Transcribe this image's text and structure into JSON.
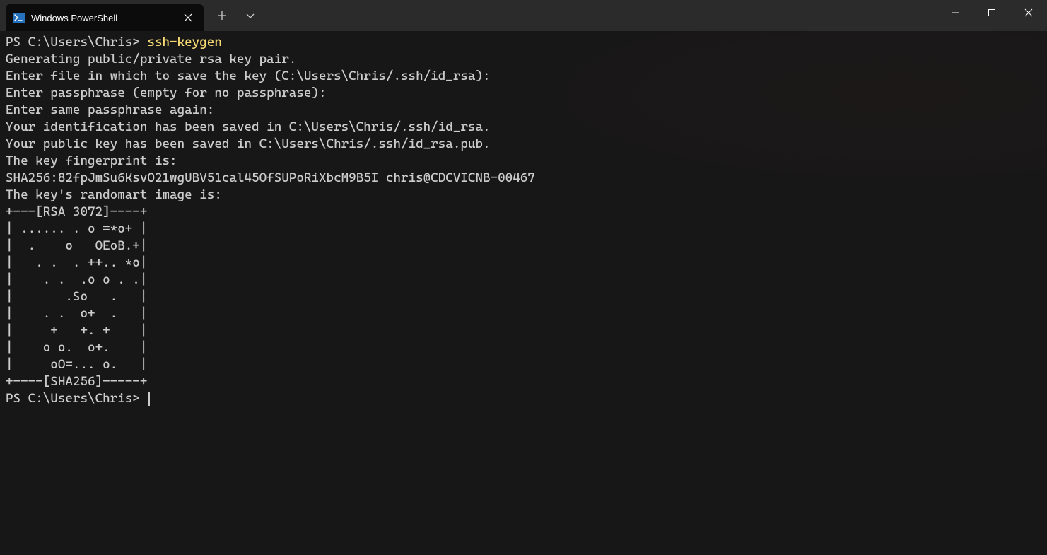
{
  "titlebar": {
    "tab_title": "Windows PowerShell",
    "new_tab_icon": "plus-icon",
    "dropdown_icon": "chevron-down-icon"
  },
  "terminal": {
    "prompt1": "PS C:\\Users\\Chris> ",
    "command1": "ssh-keygen",
    "lines": [
      "Generating public/private rsa key pair.",
      "Enter file in which to save the key (C:\\Users\\Chris/.ssh/id_rsa):",
      "Enter passphrase (empty for no passphrase):",
      "Enter same passphrase again:",
      "Your identification has been saved in C:\\Users\\Chris/.ssh/id_rsa.",
      "Your public key has been saved in C:\\Users\\Chris/.ssh/id_rsa.pub.",
      "The key fingerprint is:",
      "SHA256:82fpJmSu6KsvO21wgUBV51cal45OfSUPoRiXbcM9B5I chris@CDCVICNB-00467",
      "The key's randomart image is:",
      "+---[RSA 3072]----+",
      "| ...... . o =*o+ |",
      "|  .    o   OEoB.+|",
      "|   . .  . ++.. *o|",
      "|    . .  .o o . .|",
      "|       .So   .   |",
      "|    . .  o+  .   |",
      "|     +   +. +    |",
      "|    o o.  o+.    |",
      "|     oO=... o.   |",
      "+----[SHA256]-----+"
    ],
    "prompt2": "PS C:\\Users\\Chris> "
  }
}
